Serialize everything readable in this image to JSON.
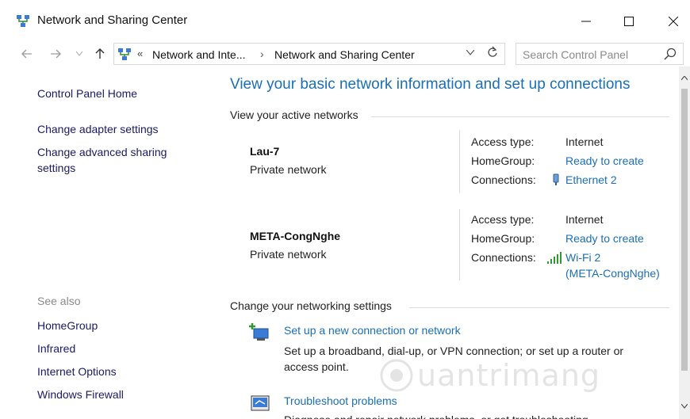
{
  "window": {
    "title": "Network and Sharing Center",
    "icon": "network-center-icon",
    "controls": {
      "minimize": "—",
      "maximize": "☐",
      "close": "✕"
    }
  },
  "nav": {
    "back": "←",
    "forward": "→",
    "recent": "∨",
    "up": "↑",
    "address": {
      "overflow": "«",
      "crumbs": [
        "Network and Inte...",
        "Network and Sharing Center"
      ],
      "separator": "›",
      "dropdown": "∨",
      "refresh": "↻"
    },
    "search": {
      "placeholder": "Search Control Panel",
      "value": ""
    }
  },
  "sidebar": {
    "links": [
      {
        "label": "Control Panel Home"
      },
      {
        "label": "Change adapter settings"
      },
      {
        "label": "Change advanced sharing settings"
      }
    ],
    "see_also_label": "See also",
    "see_also": [
      {
        "label": "HomeGroup"
      },
      {
        "label": "Infrared"
      },
      {
        "label": "Internet Options"
      },
      {
        "label": "Windows Firewall"
      }
    ]
  },
  "main": {
    "heading": "View your basic network information and set up connections",
    "active_networks_label": "View your active networks",
    "networks": [
      {
        "name": "Lau-7",
        "type": "Private network",
        "access_type_label": "Access type:",
        "access_type": "Internet",
        "homegroup_label": "HomeGroup:",
        "homegroup": "Ready to create",
        "connections_label": "Connections:",
        "connection": "Ethernet 2",
        "connection_icon": "ethernet-icon"
      },
      {
        "name": "META-CongNghe",
        "type": "Private network",
        "access_type_label": "Access type:",
        "access_type": "Internet",
        "homegroup_label": "HomeGroup:",
        "homegroup": "Ready to create",
        "connections_label": "Connections:",
        "connection_line1": "Wi-Fi 2",
        "connection_line2": "(META-CongNghe)",
        "connection_icon": "wifi-signal-icon"
      }
    ],
    "change_settings_label": "Change your networking settings",
    "actions": [
      {
        "link": "Set up a new connection or network",
        "desc": "Set up a broadband, dial-up, or VPN connection; or set up a router or access point."
      },
      {
        "link": "Troubleshoot problems",
        "desc": "Diagnose and repair network problems, or get troubleshooting"
      }
    ]
  },
  "watermark": {
    "text": "uantrimang"
  },
  "colors": {
    "link": "#1a6fb6",
    "heading": "#1a6fb6",
    "sidebar_link": "#1a1a66"
  }
}
